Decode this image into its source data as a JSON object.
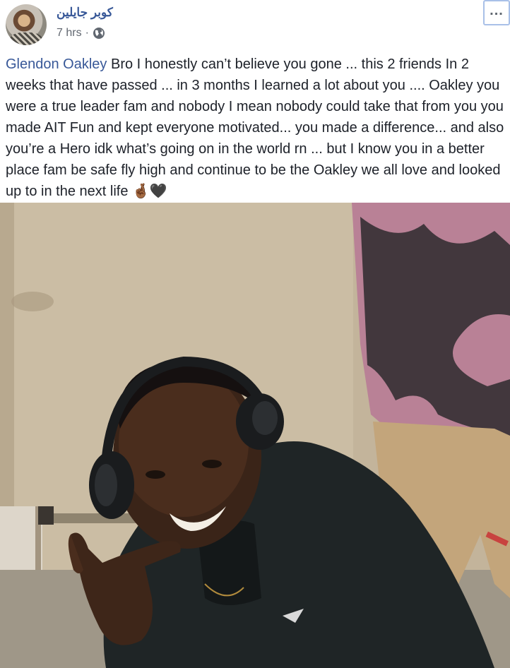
{
  "post": {
    "author": "كوبر جايلين",
    "time": "7 hrs",
    "separator": "·",
    "privacy_icon": "globe-icon",
    "more_label": "...",
    "mention": "Glendon Oakley",
    "text": " Bro I honestly can’t believe you gone ... this 2 friends In 2 weeks that have passed ... in 3 months I learned a lot about you .... Oakley you were a true leader fam and nobody I mean nobody could take that from you you made AIT Fun and kept everyone motivated... you made a difference... and also you’re a Hero idk what’s going on in the world rn ... but I know you in a better place fam be safe fly high and continue to be the Oakley we all love and looked up to in the next life ",
    "emoji": "🤞🏾🖤"
  },
  "colors": {
    "link": "#385898",
    "text": "#1d2129",
    "meta": "#616770"
  }
}
